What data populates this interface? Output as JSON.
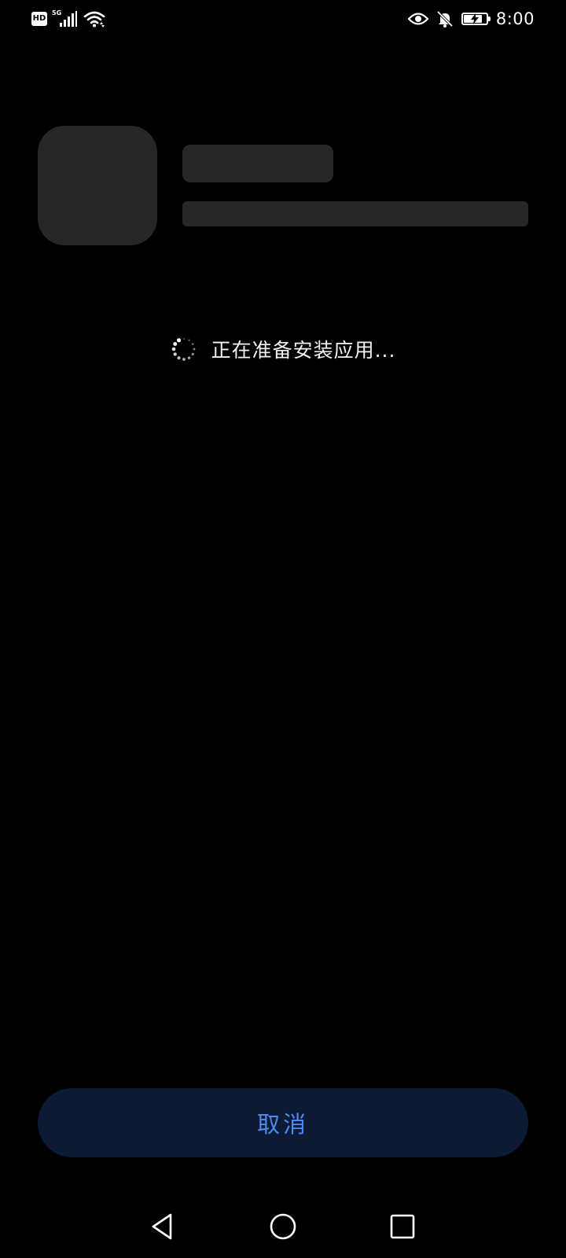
{
  "status_bar": {
    "hd_badge": "HD",
    "network_type": "5G",
    "icons": [
      "hd-icon",
      "cellular-signal-icon",
      "wifi-icon",
      "eye-comfort-icon",
      "notifications-off-icon",
      "battery-charging-icon"
    ],
    "battery_level": 0.85,
    "time": "8:00"
  },
  "installer": {
    "status_text": "正在准备安装应用...",
    "cancel_label": "取消"
  },
  "navigation_bar": {
    "icons": [
      "back-icon",
      "home-icon",
      "recents-icon"
    ]
  },
  "colors": {
    "background": "#000000",
    "placeholder": "#262626",
    "button_background": "#0c1a34",
    "accent": "#4d8af0",
    "text": "#f2f2f2"
  }
}
